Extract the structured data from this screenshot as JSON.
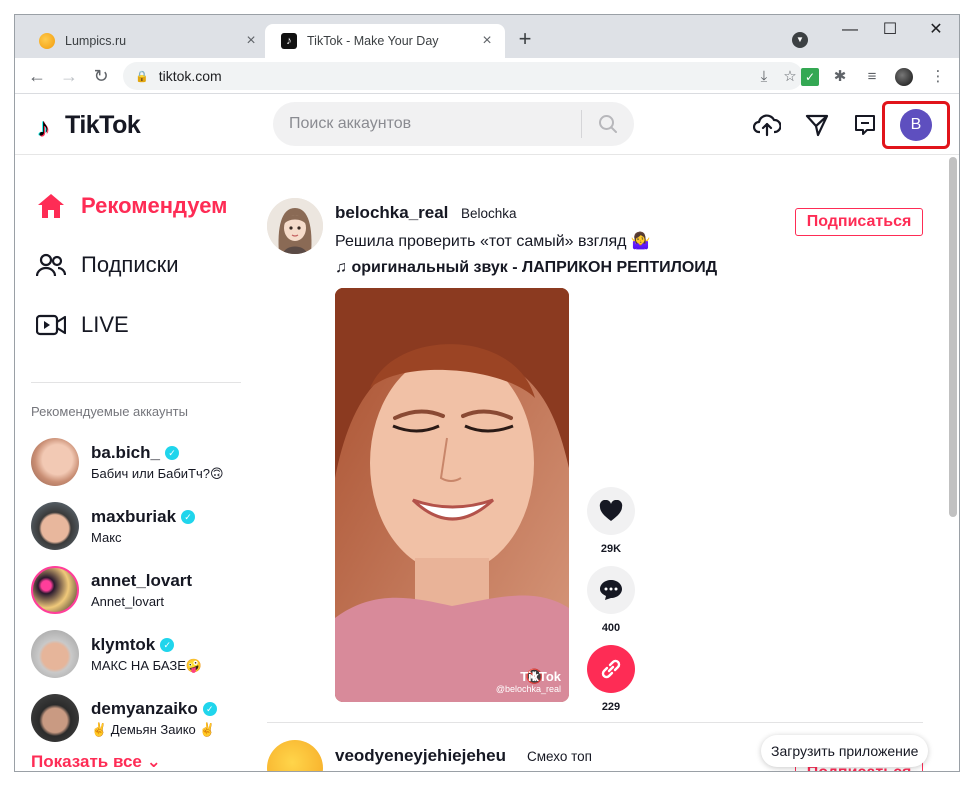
{
  "browser": {
    "tabs": [
      {
        "title": "Lumpics.ru",
        "active": false
      },
      {
        "title": "TikTok - Make Your Day",
        "active": true
      }
    ],
    "url": "tiktok.com"
  },
  "header": {
    "logo_text": "TikTok",
    "search_placeholder": "Поиск аккаунтов",
    "avatar_letter": "B",
    "highlight_color": "#e1141b"
  },
  "sidebar": {
    "nav": [
      {
        "label": "Рекомендуем",
        "icon": "home-icon",
        "active": true
      },
      {
        "label": "Подписки",
        "icon": "users-icon",
        "active": false
      },
      {
        "label": "LIVE",
        "icon": "live-icon",
        "active": false
      }
    ],
    "suggested_title": "Рекомендуемые аккаунты",
    "accounts": [
      {
        "username": "ba.bich_",
        "subtitle": "Бабич или БабиТч?🙃",
        "verified": true
      },
      {
        "username": "maxburiak",
        "subtitle": "Макс",
        "verified": true
      },
      {
        "username": "annet_lovart",
        "subtitle": "Annet_lovart",
        "verified": false
      },
      {
        "username": "klymtok",
        "subtitle": "МАКС НА БАЗЕ🤪",
        "verified": true
      },
      {
        "username": "demyanzaiko",
        "subtitle": "✌️ Демьян Заико ✌️",
        "verified": true
      }
    ],
    "show_all": "Показать все"
  },
  "feed": {
    "post": {
      "username": "belochka_real",
      "nickname": "Belochka",
      "description": "Решила проверить «тот самый» взгляд 🤷‍♀️",
      "music": "♫ оригинальный звук - ЛАПРИКОН РЕПТИЛОИД",
      "follow": "Подписаться",
      "watermark_logo": "TikTok",
      "watermark_user": "@belochka_real",
      "likes": "29K",
      "comments": "400",
      "shares": "229"
    },
    "post2": {
      "username": "veodyeneyjehiejeheu",
      "nickname": "Смехо топ",
      "follow": "Подписаться"
    }
  },
  "get_app": "Загрузить приложение",
  "colors": {
    "accent": "#fe2c55",
    "verified": "#20d5ec",
    "avatar_bg": "#5e4fbf"
  }
}
